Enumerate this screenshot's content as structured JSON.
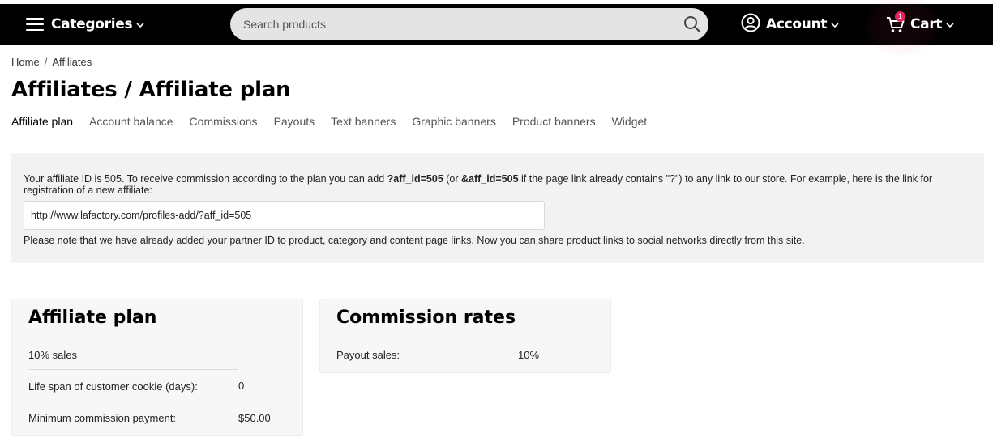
{
  "header": {
    "categories_label": "Categories",
    "search_placeholder": "Search products",
    "account_label": "Account",
    "cart_label": "Cart",
    "cart_count": "1"
  },
  "breadcrumb": {
    "home": "Home",
    "separator": "/",
    "current": "Affiliates"
  },
  "page_title": "Affiliates / Affiliate plan",
  "tabs": [
    {
      "label": "Affiliate plan",
      "active": true
    },
    {
      "label": "Account balance",
      "active": false
    },
    {
      "label": "Commissions",
      "active": false
    },
    {
      "label": "Payouts",
      "active": false
    },
    {
      "label": "Text banners",
      "active": false
    },
    {
      "label": "Graphic banners",
      "active": false
    },
    {
      "label": "Product banners",
      "active": false
    },
    {
      "label": "Widget",
      "active": false
    }
  ],
  "info": {
    "text_1": "Your affiliate ID is 505. To receive commission according to the plan you can add ",
    "param_1": "?aff_id=505",
    "text_2": " (or ",
    "param_2": "&aff_id=505",
    "text_3": " if the page link already contains \"?\") to any link to our store. For example, here is the link for registration of a new affiliate:",
    "link_value": "http://www.lafactory.com/profiles-add/?aff_id=505",
    "note": "Please note that we have already added your partner ID to product, category and content page links. Now you can share product links to social networks directly from this site."
  },
  "affiliate_plan": {
    "title": "Affiliate plan",
    "summary": "10% sales",
    "rows": [
      {
        "label": "Life span of customer cookie (days):",
        "value": "0"
      },
      {
        "label": "Minimum commission payment:",
        "value": "$50.00"
      }
    ]
  },
  "commission_rates": {
    "title": "Commission rates",
    "rows": [
      {
        "label": "Payout sales:",
        "value": "10%"
      }
    ]
  },
  "colors": {
    "topbar_bg": "#000000",
    "accent": "#e4265d",
    "panel_bg": "#f2f2f2"
  }
}
